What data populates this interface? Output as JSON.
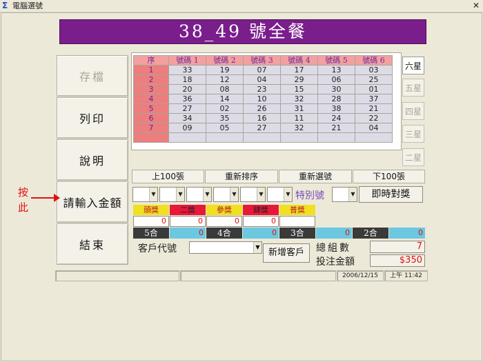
{
  "window": {
    "title": "電腦選號",
    "close_label": "✕",
    "icon": "app-icon"
  },
  "banner": {
    "text": "38_49 號全餐"
  },
  "left_buttons": [
    {
      "label": "存檔",
      "enabled": false
    },
    {
      "label": "列印",
      "enabled": true
    },
    {
      "label": "說明",
      "enabled": true
    },
    {
      "label": "請輸入金額",
      "enabled": true
    },
    {
      "label": "結束",
      "enabled": true
    }
  ],
  "hint": {
    "text": "按此"
  },
  "grid": {
    "headers": [
      "序",
      "號碼 1",
      "號碼 2",
      "號碼 3",
      "號碼 4",
      "號碼 5",
      "號碼 6"
    ],
    "rows": [
      [
        "1",
        "33",
        "19",
        "07",
        "17",
        "13",
        "03"
      ],
      [
        "2",
        "18",
        "12",
        "04",
        "29",
        "06",
        "25"
      ],
      [
        "3",
        "20",
        "08",
        "23",
        "15",
        "30",
        "01"
      ],
      [
        "4",
        "36",
        "14",
        "10",
        "32",
        "28",
        "37"
      ],
      [
        "5",
        "27",
        "02",
        "26",
        "31",
        "38",
        "21"
      ],
      [
        "6",
        "34",
        "35",
        "16",
        "11",
        "24",
        "22"
      ],
      [
        "7",
        "09",
        "05",
        "27",
        "32",
        "21",
        "04"
      ],
      [
        "",
        "",
        "",
        "",
        "",
        "",
        ""
      ]
    ]
  },
  "star_tabs": [
    {
      "label": "六星",
      "active": true
    },
    {
      "label": "五星",
      "active": false
    },
    {
      "label": "四星",
      "active": false
    },
    {
      "label": "三星",
      "active": false
    },
    {
      "label": "二星",
      "active": false
    }
  ],
  "commands": [
    "上100張",
    "重新排序",
    "重新選號",
    "下100張"
  ],
  "special": {
    "label": "特別號",
    "check_button": "即時對獎"
  },
  "prizes": [
    {
      "label": "頭獎",
      "value": "0",
      "color": "#f0e020"
    },
    {
      "label": "二獎",
      "value": "0",
      "color": "#e81838"
    },
    {
      "label": "參獎",
      "value": "0",
      "color": "#f0e020"
    },
    {
      "label": "肆獎",
      "value": "0",
      "color": "#e81838"
    },
    {
      "label": "普獎",
      "value": "",
      "color": "#f0e020"
    }
  ],
  "hits": [
    {
      "label": "5合",
      "value": "0"
    },
    {
      "label": "4合",
      "value": "0"
    },
    {
      "label": "3合",
      "value": "0"
    },
    {
      "label": "2合",
      "value": "0"
    }
  ],
  "customer": {
    "label": "客戶代號",
    "value": "",
    "add_button": "新增客戶"
  },
  "summary": {
    "total_label": "總組數",
    "total_value": "7",
    "amount_label": "投注金額",
    "amount_value": "$350"
  },
  "status": {
    "panel1": "",
    "panel2": "",
    "date": "2006/12/15",
    "time": "上午 11:42"
  }
}
